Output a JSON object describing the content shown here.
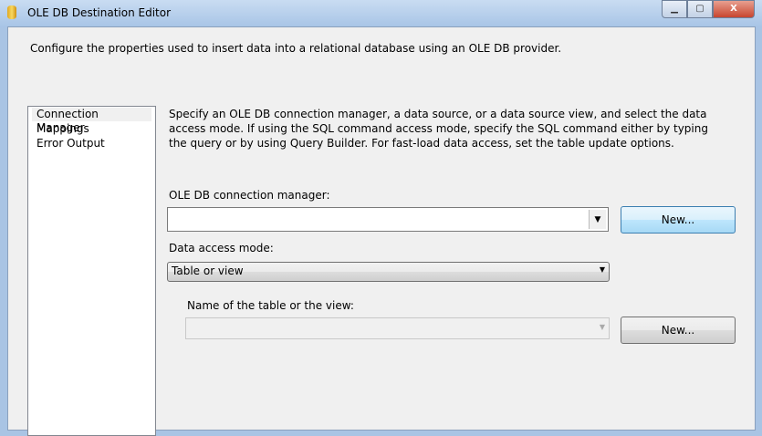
{
  "window": {
    "title": "OLE DB Destination Editor",
    "minimize": "▁",
    "maximize": "▢",
    "close": "X"
  },
  "description": "Configure the properties used to insert data into a relational database using an OLE DB provider.",
  "nav": {
    "items": [
      {
        "label": "Connection Manager",
        "selected": true
      },
      {
        "label": "Mappings"
      },
      {
        "label": "Error Output"
      }
    ]
  },
  "main": {
    "intro": "Specify an OLE DB connection manager, a data source, or a data source view, and select the data access mode. If using the SQL command access mode, specify the SQL command either by typing the query or by using Query Builder. For fast-load data access, set the table update options.",
    "connection_label": "OLE DB connection manager:",
    "connection_value": "",
    "new_button_1": "New...",
    "access_mode_label": "Data access mode:",
    "access_mode_value": "Table or view",
    "table_label": "Name of the table or the view:",
    "table_value": "",
    "new_button_2": "New...",
    "arrow": "▼"
  }
}
